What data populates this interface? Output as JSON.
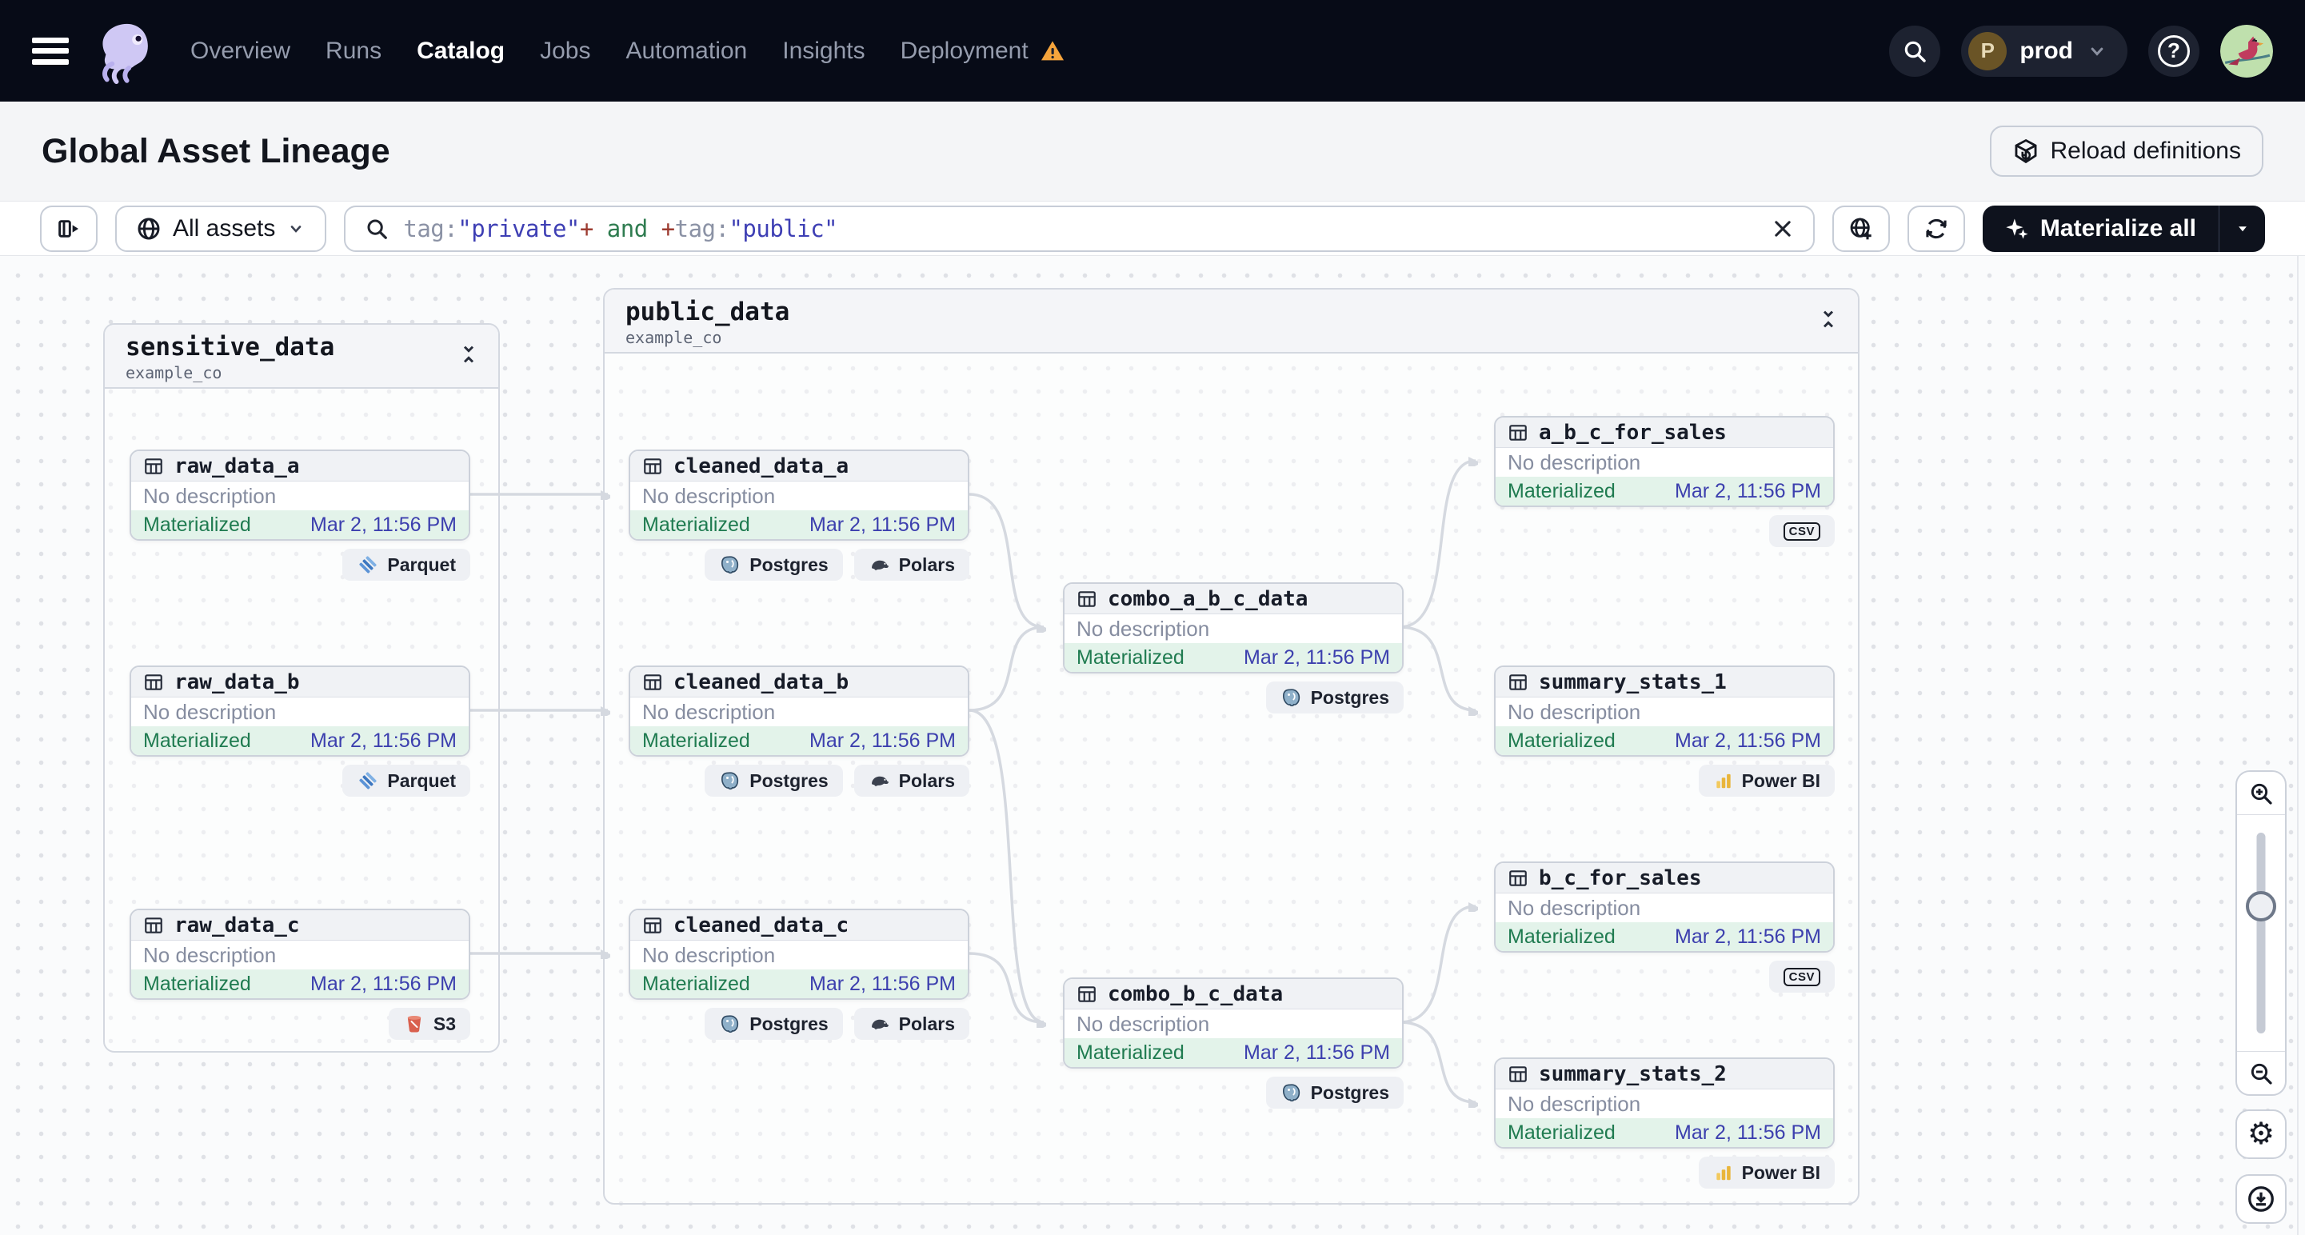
{
  "navbar": {
    "items": [
      {
        "label": "Overview",
        "active": false
      },
      {
        "label": "Runs",
        "active": false
      },
      {
        "label": "Catalog",
        "active": true
      },
      {
        "label": "Jobs",
        "active": false
      },
      {
        "label": "Automation",
        "active": false
      },
      {
        "label": "Insights",
        "active": false
      },
      {
        "label": "Deployment",
        "active": false,
        "warning": true
      }
    ],
    "environment": {
      "abbr": "P",
      "name": "prod"
    },
    "help_glyph": "?"
  },
  "header": {
    "title": "Global Asset Lineage",
    "reload_label": "Reload definitions"
  },
  "toolbar": {
    "scope_label": "All assets",
    "materialize_label": "Materialize all",
    "query_segments": [
      {
        "text": "tag:",
        "color": "#8b92a5"
      },
      {
        "text": "\"private\"",
        "color": "#3e3fb4"
      },
      {
        "text": "+",
        "color": "#9d3c31"
      },
      {
        "text": " and ",
        "color": "#2f7c50"
      },
      {
        "text": "+",
        "color": "#9d3c31"
      },
      {
        "text": "tag:",
        "color": "#8b92a5"
      },
      {
        "text": "\"public\"",
        "color": "#3e3fb4"
      }
    ]
  },
  "graph": {
    "groups": [
      {
        "name": "sensitive_data",
        "repo": "example_co",
        "nodes": [
          {
            "name": "raw_data_a",
            "description": "No description",
            "status": "Materialized",
            "timestamp": "Mar 2, 11:56 PM",
            "tags": [
              "Parquet"
            ]
          },
          {
            "name": "raw_data_b",
            "description": "No description",
            "status": "Materialized",
            "timestamp": "Mar 2, 11:56 PM",
            "tags": [
              "Parquet"
            ]
          },
          {
            "name": "raw_data_c",
            "description": "No description",
            "status": "Materialized",
            "timestamp": "Mar 2, 11:56 PM",
            "tags": [
              "S3"
            ]
          }
        ]
      },
      {
        "name": "public_data",
        "repo": "example_co",
        "nodes": [
          {
            "name": "cleaned_data_a",
            "description": "No description",
            "status": "Materialized",
            "timestamp": "Mar 2, 11:56 PM",
            "tags": [
              "Postgres",
              "Polars"
            ]
          },
          {
            "name": "cleaned_data_b",
            "description": "No description",
            "status": "Materialized",
            "timestamp": "Mar 2, 11:56 PM",
            "tags": [
              "Postgres",
              "Polars"
            ]
          },
          {
            "name": "cleaned_data_c",
            "description": "No description",
            "status": "Materialized",
            "timestamp": "Mar 2, 11:56 PM",
            "tags": [
              "Postgres",
              "Polars"
            ]
          },
          {
            "name": "combo_a_b_c_data",
            "description": "No description",
            "status": "Materialized",
            "timestamp": "Mar 2, 11:56 PM",
            "tags": [
              "Postgres"
            ]
          },
          {
            "name": "combo_b_c_data",
            "description": "No description",
            "status": "Materialized",
            "timestamp": "Mar 2, 11:56 PM",
            "tags": [
              "Postgres"
            ]
          },
          {
            "name": "a_b_c_for_sales",
            "description": "No description",
            "status": "Materialized",
            "timestamp": "Mar 2, 11:56 PM",
            "tags": [
              "CSV"
            ]
          },
          {
            "name": "summary_stats_1",
            "description": "No description",
            "status": "Materialized",
            "timestamp": "Mar 2, 11:56 PM",
            "tags": [
              "Power BI"
            ]
          },
          {
            "name": "b_c_for_sales",
            "description": "No description",
            "status": "Materialized",
            "timestamp": "Mar 2, 11:56 PM",
            "tags": [
              "CSV"
            ]
          },
          {
            "name": "summary_stats_2",
            "description": "No description",
            "status": "Materialized",
            "timestamp": "Mar 2, 11:56 PM",
            "tags": [
              "Power BI"
            ]
          }
        ]
      }
    ]
  },
  "icons": {
    "gear": "⚙",
    "colors": {
      "status_green": "#1f7b50",
      "timestamp_indigo": "#3c3fae",
      "warning_orange": "#f5a43c",
      "materialize_bg": "#0e121d",
      "edge_gray": "#d5d9e0"
    }
  }
}
